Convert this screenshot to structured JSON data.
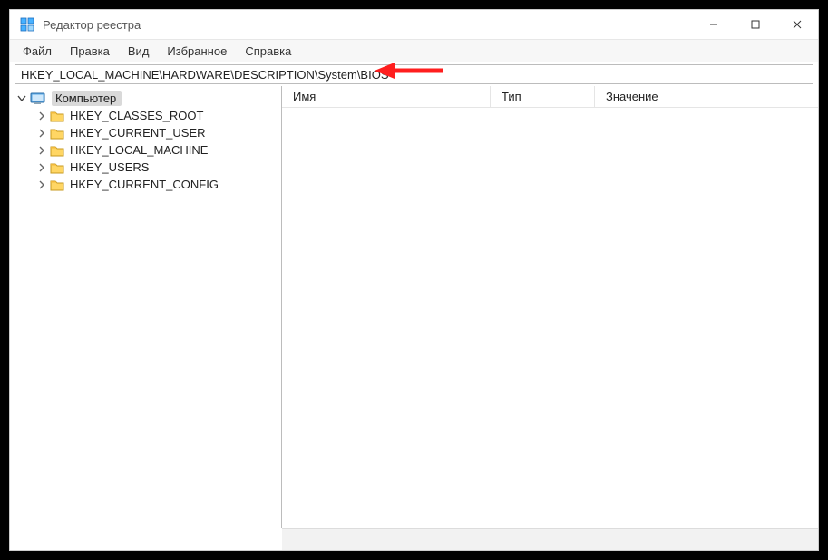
{
  "window": {
    "title": "Редактор реестра"
  },
  "menu": {
    "file": "Файл",
    "edit": "Правка",
    "view": "Вид",
    "favorites": "Избранное",
    "help": "Справка"
  },
  "address": "HKEY_LOCAL_MACHINE\\HARDWARE\\DESCRIPTION\\System\\BIOS",
  "tree": {
    "root": "Компьютер",
    "hives": [
      "HKEY_CLASSES_ROOT",
      "HKEY_CURRENT_USER",
      "HKEY_LOCAL_MACHINE",
      "HKEY_USERS",
      "HKEY_CURRENT_CONFIG"
    ]
  },
  "columns": {
    "name": "Имя",
    "type": "Тип",
    "value": "Значение"
  }
}
